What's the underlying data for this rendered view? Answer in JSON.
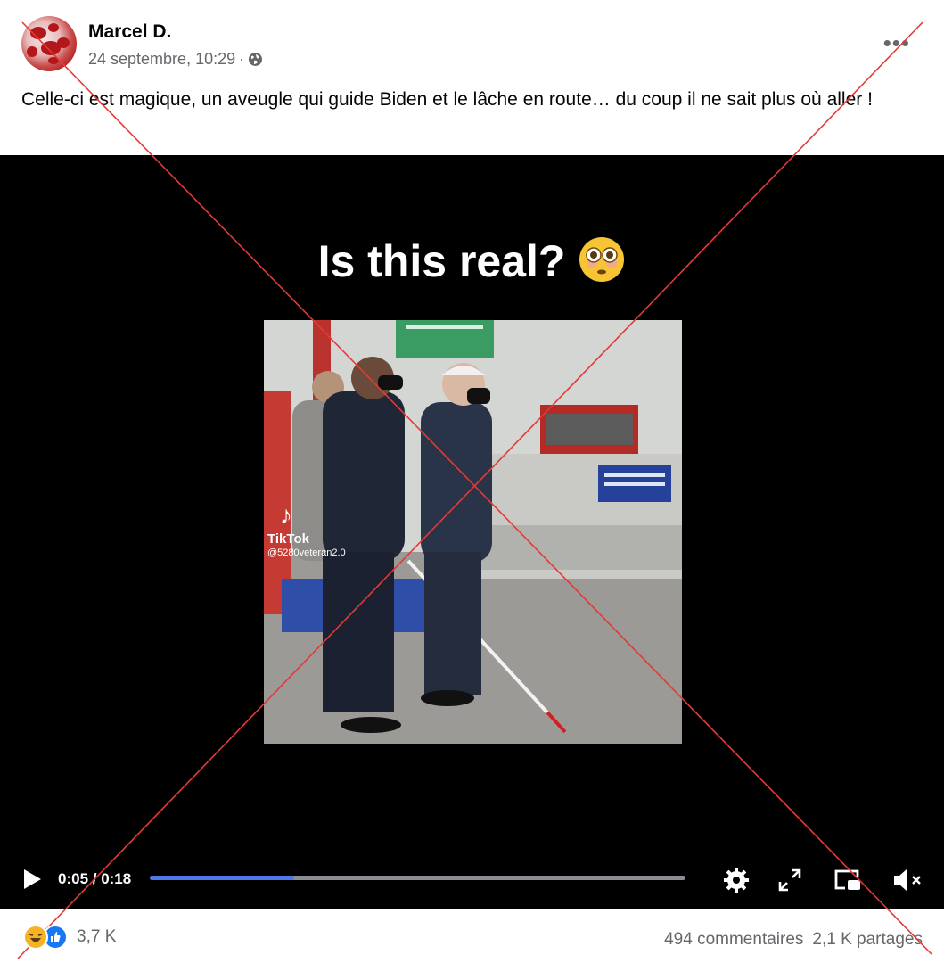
{
  "post": {
    "author": "Marcel D.",
    "date": "24 septembre, 10:29",
    "separator": "·",
    "privacy_icon": "globe-icon",
    "more_label": "•••",
    "text": "Celle-ci est magique, un aveugle qui guide Biden et le lâche en route… du coup il ne sait plus où aller !"
  },
  "video": {
    "overlay_text": "Is this real?",
    "overlay_emoji": "flushed-face-emoji",
    "watermark": {
      "app": "TikTok",
      "handle": "@5280veteran2.0"
    },
    "time": "0:05 / 0:18",
    "progress": 0.27
  },
  "footer": {
    "reaction_count": "3,7 K",
    "comments": "494 commentaires",
    "shares": "2,1 K partages"
  },
  "colors": {
    "progress_fill": "#4c78e8",
    "cross": "#e53935",
    "secondary_text": "#65676b"
  }
}
